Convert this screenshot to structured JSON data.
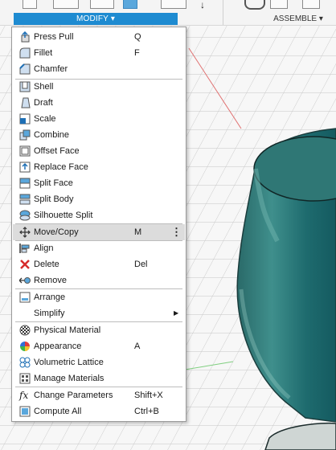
{
  "toolbar": {
    "modify_label": "MODIFY ▾",
    "assemble_label": "ASSEMBLE ▾"
  },
  "menu": {
    "items": [
      {
        "label": "Press Pull",
        "shortcut": "Q",
        "icon": "press-pull-icon"
      },
      {
        "label": "Fillet",
        "shortcut": "F",
        "icon": "fillet-icon"
      },
      {
        "label": "Chamfer",
        "shortcut": "",
        "icon": "chamfer-icon"
      },
      {
        "label": "Shell",
        "shortcut": "",
        "icon": "shell-icon"
      },
      {
        "label": "Draft",
        "shortcut": "",
        "icon": "draft-icon"
      },
      {
        "label": "Scale",
        "shortcut": "",
        "icon": "scale-icon"
      },
      {
        "label": "Combine",
        "shortcut": "",
        "icon": "combine-icon"
      },
      {
        "label": "Offset Face",
        "shortcut": "",
        "icon": "offset-face-icon"
      },
      {
        "label": "Replace Face",
        "shortcut": "",
        "icon": "replace-face-icon"
      },
      {
        "label": "Split Face",
        "shortcut": "",
        "icon": "split-face-icon"
      },
      {
        "label": "Split Body",
        "shortcut": "",
        "icon": "split-body-icon"
      },
      {
        "label": "Silhouette Split",
        "shortcut": "",
        "icon": "silhouette-split-icon"
      },
      {
        "label": "Move/Copy",
        "shortcut": "M",
        "icon": "move-copy-icon",
        "highlighted": true,
        "more": "⋮"
      },
      {
        "label": "Align",
        "shortcut": "",
        "icon": "align-icon"
      },
      {
        "label": "Delete",
        "shortcut": "Del",
        "icon": "delete-icon"
      },
      {
        "label": "Remove",
        "shortcut": "",
        "icon": "remove-icon"
      },
      {
        "label": "Arrange",
        "shortcut": "",
        "icon": "arrange-icon"
      },
      {
        "label": "Simplify",
        "shortcut": "",
        "icon": "",
        "submenu": "▶"
      },
      {
        "label": "Physical Material",
        "shortcut": "",
        "icon": "physical-material-icon"
      },
      {
        "label": "Appearance",
        "shortcut": "A",
        "icon": "appearance-icon"
      },
      {
        "label": "Volumetric Lattice",
        "shortcut": "",
        "icon": "volumetric-lattice-icon"
      },
      {
        "label": "Manage Materials",
        "shortcut": "",
        "icon": "manage-materials-icon"
      },
      {
        "label": "Change Parameters",
        "shortcut": "Shift+X",
        "icon": "fx-icon",
        "icon_text": "fx"
      },
      {
        "label": "Compute All",
        "shortcut": "Ctrl+B",
        "icon": "compute-all-icon"
      }
    ]
  }
}
